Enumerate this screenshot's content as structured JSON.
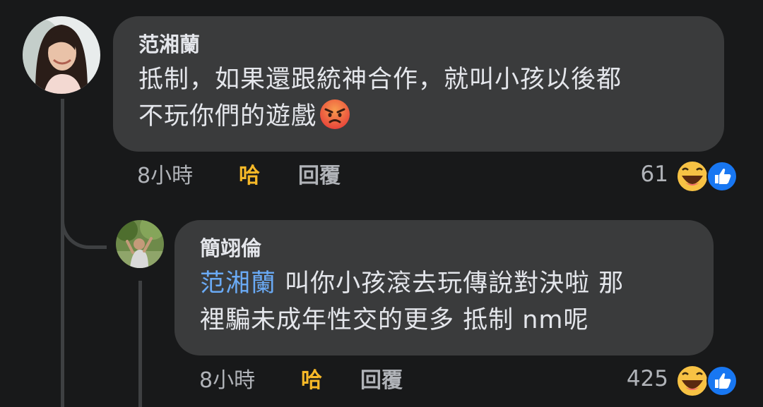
{
  "comments": [
    {
      "author": "范湘蘭",
      "text_line1": "抵制，如果還跟統神合作，就叫小孩以後都",
      "text_line2": "不玩你們的遊戲",
      "emoji": "angry-face",
      "time": "8小時",
      "reaction_label": "哈",
      "reply_label": "回覆",
      "reaction_count": "61"
    },
    {
      "author": "簡翊倫",
      "mention": "范湘蘭",
      "text_line1": " 叫你小孩滾去玩傳說對決啦 那",
      "text_line2": "裡騙未成年性交的更多 抵制 nm呢",
      "time": "8小時",
      "reaction_label": "哈",
      "reply_label": "回覆",
      "reaction_count": "425"
    }
  ],
  "colors": {
    "background": "#18191a",
    "bubble": "#3a3b3c",
    "mention": "#6aaaf5",
    "haha_label": "#f7b928",
    "like_blue": "#1877f2"
  },
  "icons": [
    "haha-reaction-icon",
    "like-reaction-icon",
    "angry-emoji-icon"
  ]
}
